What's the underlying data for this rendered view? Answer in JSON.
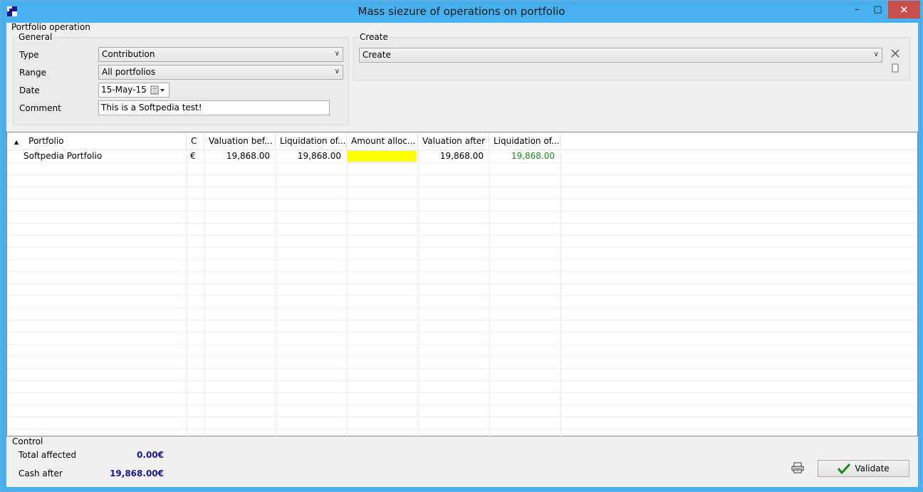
{
  "window": {
    "title": "Mass siezure of operations on portfolio",
    "controls": {
      "minimize": "–",
      "maximize": "□",
      "close": "✕"
    }
  },
  "operation": {
    "group_label": "Portfolio operation",
    "general": {
      "label": "General",
      "type_label": "Type",
      "type_value": "Contribution",
      "range_label": "Range",
      "range_value": "All portfolios",
      "date_label": "Date",
      "date_value": "15-May-15",
      "comment_label": "Comment",
      "comment_value": "This is a Softpedia test!"
    },
    "create": {
      "label": "Create",
      "value": "Create"
    }
  },
  "grid": {
    "columns": [
      "Portfolio",
      "C",
      "Valuation bef...",
      "Liquidation of...",
      "Amount alloc...",
      "Valuation after",
      "Liquidation of..."
    ],
    "sort_indicator": "▲",
    "rows": [
      {
        "portfolio": "Softpedia Portfolio",
        "currency": "€",
        "valuation_before": "19,868.00",
        "liquidation_before": "19,868.00",
        "amount_allocated": "",
        "valuation_after": "19,868.00",
        "liquidation_after": "19,868.00"
      }
    ],
    "highlight_color": "#ffff00",
    "positive_color": "#1a8a1a"
  },
  "control": {
    "label": "Control",
    "total_affected_label": "Total affected",
    "total_affected_value": "0.00€",
    "cash_after_label": "Cash after",
    "cash_after_value": "19,868.00€",
    "validate_label": "Validate"
  },
  "icons": {
    "app": "app-icon",
    "clear": "close-x-icon",
    "copy": "copy-icon",
    "print": "printer-icon",
    "calendar": "calendar-icon",
    "check": "checkmark-icon"
  }
}
